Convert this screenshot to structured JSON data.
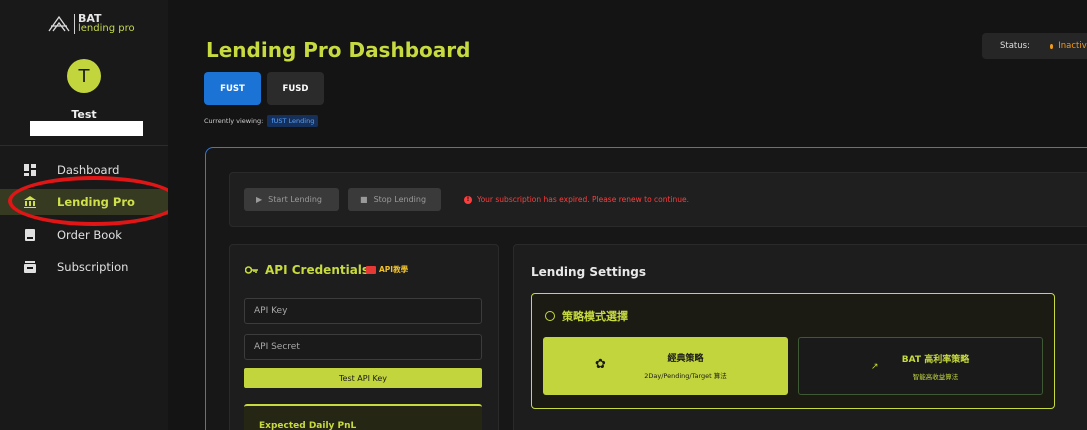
{
  "brand": {
    "name": "BAT",
    "sub": "lending pro"
  },
  "user": {
    "initial": "T",
    "name": "Test"
  },
  "nav": {
    "items": [
      {
        "label": "Dashboard",
        "icon": "dashboard-icon"
      },
      {
        "label": "Lending Pro",
        "icon": "bank-icon",
        "active": true
      },
      {
        "label": "Order Book",
        "icon": "book-icon"
      },
      {
        "label": "Subscription",
        "icon": "subscription-icon"
      }
    ]
  },
  "header": {
    "title": "Lending Pro Dashboard",
    "status_label": "Status:",
    "status_value": "Inactive"
  },
  "tabs": {
    "fust": "FUST",
    "fusd": "FUSD",
    "viewing_label": "Currently viewing:",
    "viewing_value": "fUST Lending"
  },
  "controls": {
    "start": "Start Lending",
    "stop": "Stop Lending",
    "error": "Your subscription has expired. Please renew to continue."
  },
  "api": {
    "title": "API Credentials",
    "tag": "API教學",
    "key_placeholder": "API Key",
    "secret_placeholder": "API Secret",
    "test_button": "Test API Key",
    "pnl_title": "Expected Daily PnL"
  },
  "settings": {
    "title": "Lending Settings",
    "strategy_title": "策略模式選擇",
    "classic_title": "經典策略",
    "classic_sub": "2Day/Pending/Target 算法",
    "bat_title": "BAT 高利率策略",
    "bat_sub": "智能高收益算法"
  },
  "colors": {
    "accent": "#c7da3f",
    "primary_tab": "#1b73d6",
    "error": "#ff3d3d",
    "status_inactive": "#f39c12",
    "panel_border": "#2f7be6"
  }
}
